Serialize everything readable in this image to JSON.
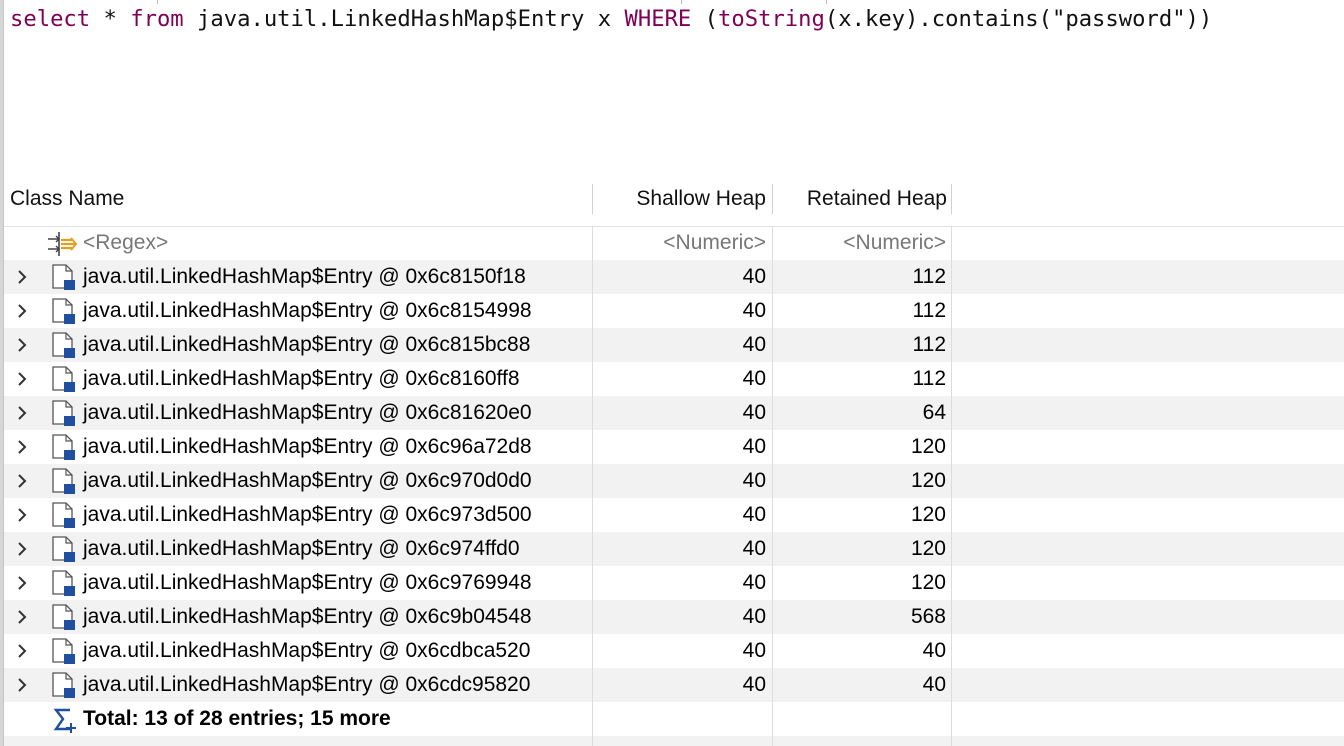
{
  "query": {
    "keyword_select": "select",
    "star": " * ",
    "keyword_from": "from",
    "class_part": " java.util.LinkedHashMap$Entry x ",
    "keyword_where": "WHERE",
    "space": " ",
    "paren_open": "(",
    "keyword_tostring": "toString",
    "rest": "(x.key).contains(\"password\"))"
  },
  "table": {
    "columns": {
      "class_name": "Class Name",
      "shallow_heap": "Shallow Heap",
      "retained_heap": "Retained Heap"
    },
    "filter_row": {
      "class_name": "<Regex>",
      "shallow_heap": "<Numeric>",
      "retained_heap": "<Numeric>",
      "icon": "regex-filter-icon"
    },
    "rows": [
      {
        "name": "java.util.LinkedHashMap$Entry @ 0x6c8150f18",
        "shallow": "40",
        "retained": "112"
      },
      {
        "name": "java.util.LinkedHashMap$Entry @ 0x6c8154998",
        "shallow": "40",
        "retained": "112"
      },
      {
        "name": "java.util.LinkedHashMap$Entry @ 0x6c815bc88",
        "shallow": "40",
        "retained": "112"
      },
      {
        "name": "java.util.LinkedHashMap$Entry @ 0x6c8160ff8",
        "shallow": "40",
        "retained": "112"
      },
      {
        "name": "java.util.LinkedHashMap$Entry @ 0x6c81620e0",
        "shallow": "40",
        "retained": "64"
      },
      {
        "name": "java.util.LinkedHashMap$Entry @ 0x6c96a72d8",
        "shallow": "40",
        "retained": "120"
      },
      {
        "name": "java.util.LinkedHashMap$Entry @ 0x6c970d0d0",
        "shallow": "40",
        "retained": "120"
      },
      {
        "name": "java.util.LinkedHashMap$Entry @ 0x6c973d500",
        "shallow": "40",
        "retained": "120"
      },
      {
        "name": "java.util.LinkedHashMap$Entry @ 0x6c974ffd0",
        "shallow": "40",
        "retained": "120"
      },
      {
        "name": "java.util.LinkedHashMap$Entry @ 0x6c9769948",
        "shallow": "40",
        "retained": "120"
      },
      {
        "name": "java.util.LinkedHashMap$Entry @ 0x6c9b04548",
        "shallow": "40",
        "retained": "568"
      },
      {
        "name": "java.util.LinkedHashMap$Entry @ 0x6cdbca520",
        "shallow": "40",
        "retained": "40"
      },
      {
        "name": "java.util.LinkedHashMap$Entry @ 0x6cdc95820",
        "shallow": "40",
        "retained": "40"
      }
    ],
    "row_icon": "object-instance-icon",
    "expand_icon": "chevron-right-icon",
    "total": {
      "text": "Total: 13 of 28 entries; 15 more",
      "icon": "sum-icon"
    }
  },
  "colors": {
    "keyword": "#7f0055",
    "alt_row": "#f2f2f2",
    "icon_blue": "#1f4f9e",
    "regex_icon": "#e0a020"
  }
}
